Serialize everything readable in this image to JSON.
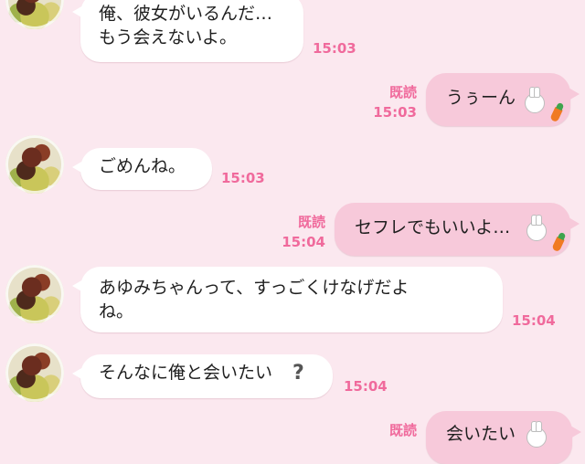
{
  "colors": {
    "background": "#fbe8ef",
    "incoming_bubble": "#ffffff",
    "outgoing_bubble": "#f7c9da",
    "meta_text": "#f06a9c"
  },
  "messages": [
    {
      "direction": "in",
      "text": "俺、彼女がいるんだ…\nもう会えないよ。",
      "time": "15:03"
    },
    {
      "direction": "out",
      "text": "うぅーん",
      "read": "既読",
      "time": "15:03",
      "sticker": "rabbit-carrot-emoji"
    },
    {
      "direction": "in",
      "text": "ごめんね。",
      "time": "15:03"
    },
    {
      "direction": "out",
      "text": "セフレでもいいよ…",
      "read": "既読",
      "time": "15:04",
      "sticker": "rabbit-carrot-emoji"
    },
    {
      "direction": "in",
      "text": "あゆみちゃんって、すっごくけなげだよ\nね。",
      "time": "15:04"
    },
    {
      "direction": "in",
      "text": "そんなに俺と会いたい",
      "time": "15:04",
      "emoji": "question-mark-emoji"
    },
    {
      "direction": "out",
      "text": "会いたい",
      "read": "既読",
      "sticker": "rabbit-carrot-emoji"
    }
  ]
}
